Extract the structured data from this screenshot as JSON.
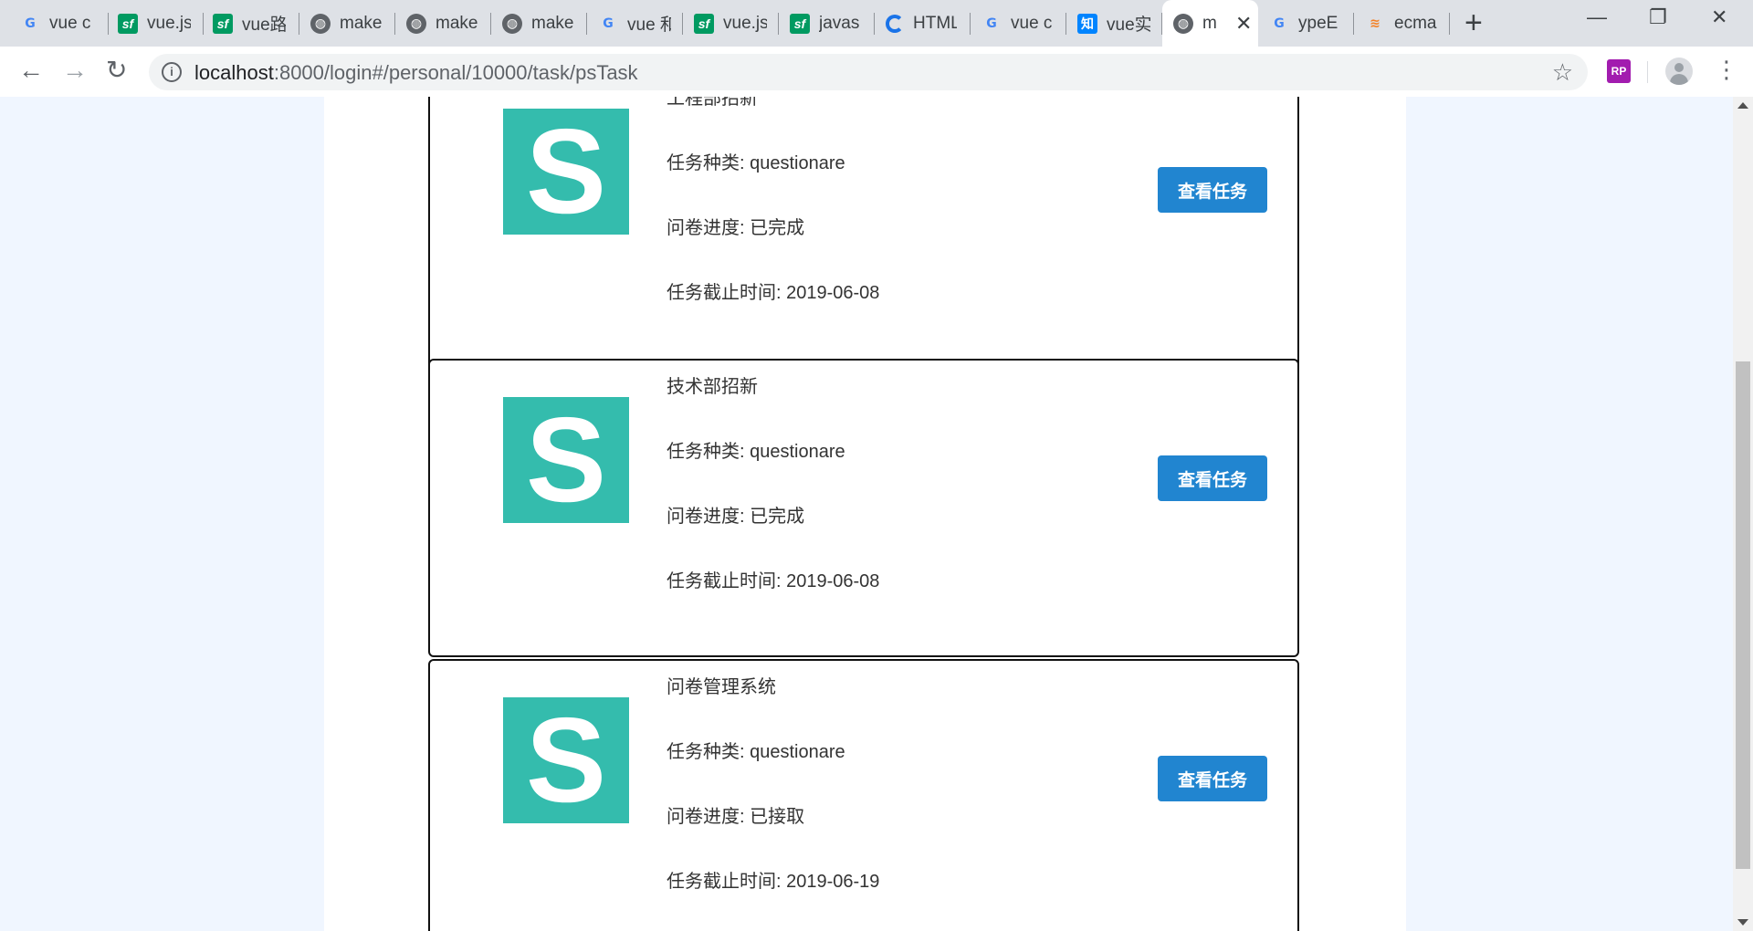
{
  "browser": {
    "tabs": [
      {
        "title": "vue c",
        "icon": "google-icon",
        "active": false
      },
      {
        "title": "vue.js",
        "icon": "segmentfault-icon",
        "active": false
      },
      {
        "title": "vue路",
        "icon": "segmentfault-icon",
        "active": false
      },
      {
        "title": "make",
        "icon": "globe-icon",
        "active": false
      },
      {
        "title": "make",
        "icon": "globe-icon",
        "active": false
      },
      {
        "title": "make",
        "icon": "globe-icon",
        "active": false
      },
      {
        "title": "vue 和",
        "icon": "google-icon",
        "active": false
      },
      {
        "title": "vue.js",
        "icon": "segmentfault-icon",
        "active": false
      },
      {
        "title": "javas",
        "icon": "segmentfault-icon",
        "active": false
      },
      {
        "title": "HTML",
        "icon": "chrome-c-icon",
        "active": false
      },
      {
        "title": "vue c",
        "icon": "google-icon",
        "active": false
      },
      {
        "title": "vue实",
        "icon": "zhihu-icon",
        "active": false
      },
      {
        "title": "m",
        "icon": "globe-icon",
        "active": true
      },
      {
        "title": "ypeE",
        "icon": "google-icon",
        "active": false
      },
      {
        "title": "ecma",
        "icon": "stackoverflow-icon",
        "active": false
      }
    ],
    "address": {
      "host": "localhost",
      "path": ":8000/login#/personal/10000/task/psTask"
    },
    "extension_label": "RP"
  },
  "tasks": [
    {
      "logo_letter": "S",
      "name": "工程部招新",
      "type": "任务种类: questionare",
      "progress": "问卷进度: 已完成",
      "deadline": "任务截止时间: 2019-06-08",
      "button": "查看任务"
    },
    {
      "logo_letter": "S",
      "name": "技术部招新",
      "type": "任务种类: questionare",
      "progress": "问卷进度: 已完成",
      "deadline": "任务截止时间: 2019-06-08",
      "button": "查看任务"
    },
    {
      "logo_letter": "S",
      "name": "问卷管理系统",
      "type": "任务种类: questionare",
      "progress": "问卷进度: 已接取",
      "deadline": "任务截止时间: 2019-06-19",
      "button": "查看任务"
    }
  ],
  "colors": {
    "logo_bg": "#34bcad",
    "button_bg": "#2185d0",
    "page_bg": "#f0f6ff"
  }
}
